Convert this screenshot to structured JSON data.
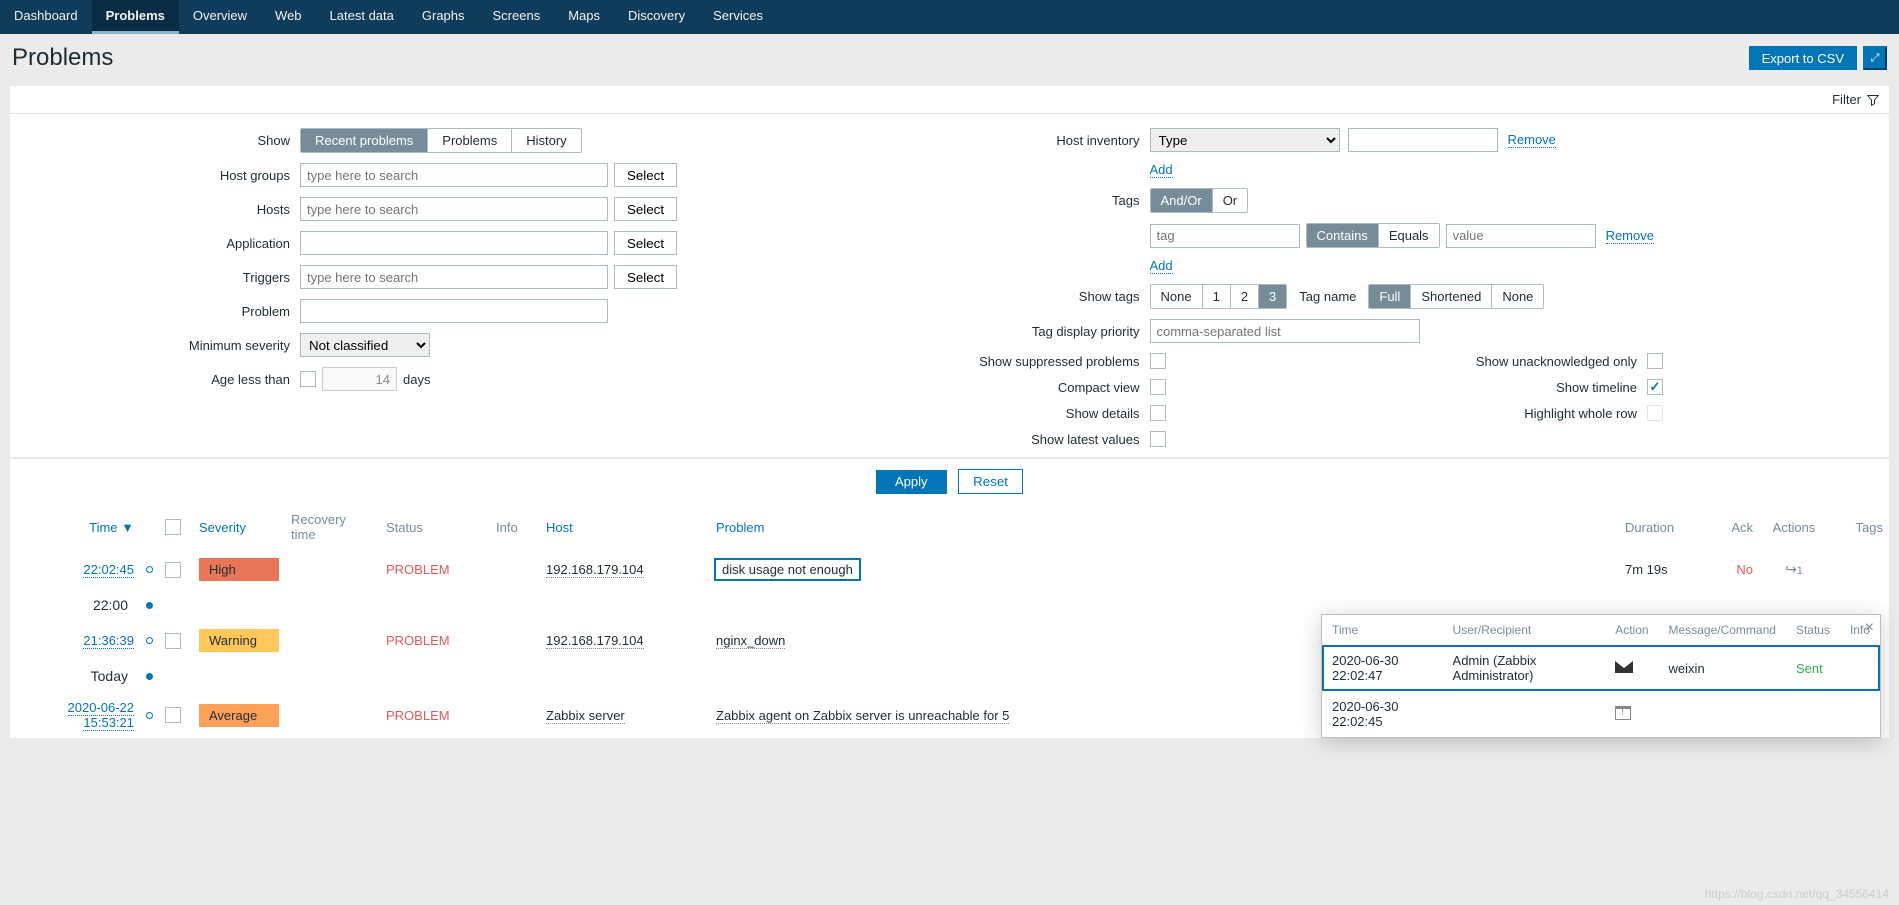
{
  "nav": [
    "Dashboard",
    "Problems",
    "Overview",
    "Web",
    "Latest data",
    "Graphs",
    "Screens",
    "Maps",
    "Discovery",
    "Services"
  ],
  "nav_active": 1,
  "page_title": "Problems",
  "export_btn": "Export to CSV",
  "filter_label": "Filter",
  "filter": {
    "show_label": "Show",
    "show_opts": [
      "Recent problems",
      "Problems",
      "History"
    ],
    "show_active": 0,
    "hostgroups_label": "Host groups",
    "hosts_label": "Hosts",
    "application_label": "Application",
    "triggers_label": "Triggers",
    "problem_label": "Problem",
    "min_sev_label": "Minimum severity",
    "min_sev_value": "Not classified",
    "age_label": "Age less than",
    "age_value": "14",
    "age_unit": "days",
    "search_placeholder": "type here to search",
    "select_btn": "Select",
    "host_inv_label": "Host inventory",
    "host_inv_type": "Type",
    "remove": "Remove",
    "add": "Add",
    "tags_label": "Tags",
    "tags_mode": [
      "And/Or",
      "Or"
    ],
    "tags_mode_active": 0,
    "tag_ph": "tag",
    "tag_op": [
      "Contains",
      "Equals"
    ],
    "tag_op_active": 0,
    "value_ph": "value",
    "show_tags_label": "Show tags",
    "show_tags_opts": [
      "None",
      "1",
      "2",
      "3"
    ],
    "show_tags_active": 3,
    "tag_name_label": "Tag name",
    "tag_name_opts": [
      "Full",
      "Shortened",
      "None"
    ],
    "tag_name_active": 0,
    "tag_prio_label": "Tag display priority",
    "tag_prio_ph": "comma-separated list",
    "suppressed_label": "Show suppressed problems",
    "unack_label": "Show unacknowledged only",
    "compact_label": "Compact view",
    "timeline_label": "Show timeline",
    "details_label": "Show details",
    "highlight_label": "Highlight whole row",
    "latest_label": "Show latest values",
    "apply": "Apply",
    "reset": "Reset"
  },
  "cols": {
    "time": "Time",
    "severity": "Severity",
    "recovery": "Recovery time",
    "status": "Status",
    "info": "Info",
    "host": "Host",
    "problem": "Problem",
    "duration": "Duration",
    "ack": "Ack",
    "actions": "Actions",
    "tags": "Tags"
  },
  "rows": [
    {
      "time": "22:02:45",
      "sev": "High",
      "sev_class": "sev-high",
      "status": "PROBLEM",
      "host": "192.168.179.104",
      "problem": "disk usage not enough",
      "duration": "7m 19s",
      "ack": "No",
      "actions": "1",
      "hl": true
    },
    {
      "sep": "22:00"
    },
    {
      "time": "21:36:39",
      "sev": "Warning",
      "sev_class": "sev-warn",
      "status": "PROBLEM",
      "host": "192.168.179.104",
      "problem": "nginx_down",
      "duration": "",
      "ack": "",
      "actions": ""
    },
    {
      "sep": "Today"
    },
    {
      "time": "2020-06-22 15:53:21",
      "sev": "Average",
      "sev_class": "sev-avg",
      "status": "PROBLEM",
      "host": "Zabbix server",
      "problem": "Zabbix agent on Zabbix server is unreachable for 5",
      "duration": "",
      "ack": "",
      "actions": ""
    }
  ],
  "popup": {
    "cols": [
      "Time",
      "User/Recipient",
      "Action",
      "Message/Command",
      "Status",
      "Info"
    ],
    "rows": [
      {
        "time": "2020-06-30 22:02:47",
        "user": "Admin (Zabbix Administrator)",
        "action": "mail",
        "msg": "weixin",
        "status": "Sent",
        "hl": true
      },
      {
        "time": "2020-06-30 22:02:45",
        "user": "",
        "action": "cal",
        "msg": "",
        "status": ""
      }
    ]
  },
  "watermark": "https://blog.csdn.net/qq_34556414"
}
